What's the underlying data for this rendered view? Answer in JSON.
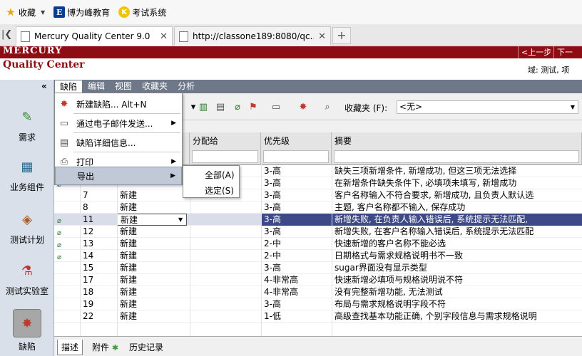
{
  "favorites_bar": {
    "favorites_label": "收藏",
    "links": [
      {
        "icon": "e-logo-icon",
        "label": "博为峰教育"
      },
      {
        "icon": "k-logo-icon",
        "label": "考试系统"
      }
    ]
  },
  "tabs": [
    {
      "title": "Mercury Quality Center 9.0",
      "active": true
    },
    {
      "title": "http://classone189:8080/qc...",
      "active": false
    }
  ],
  "header": {
    "logo": "MERCURY",
    "product": "Quality Center",
    "prev": "<上一步",
    "next": "下一步",
    "domain": "域: 测试, 项"
  },
  "sidebar": {
    "items": [
      {
        "label": "需求",
        "icon": "requirements-icon"
      },
      {
        "label": "业务组件",
        "icon": "business-components-icon"
      },
      {
        "label": "测试计划",
        "icon": "test-plan-icon"
      },
      {
        "label": "测试实验室",
        "icon": "test-lab-icon"
      },
      {
        "label": "缺陷",
        "icon": "defects-icon"
      }
    ]
  },
  "menubar": [
    "缺陷",
    "编辑",
    "视图",
    "收藏夹",
    "分析"
  ],
  "toolbar": {
    "favorites_label": "收藏夹 (F):",
    "favorites_value": "<无>"
  },
  "grid": {
    "columns": {
      "assign": "分配给",
      "priority": "优先级",
      "summary": "摘要"
    },
    "rows": [
      {
        "id": "",
        "status": "",
        "priority": "3-高",
        "summary": "缺失三项新增条件, 新增成功, 但这三项无法选择",
        "attach": false
      },
      {
        "id": "",
        "status": "",
        "priority": "3-高",
        "summary": "在新增条件缺失条件下, 必填项未填写, 新增成功",
        "attach": true
      },
      {
        "id": "7",
        "status": "新建",
        "priority": "3-高",
        "summary": "客户名称输入不符合要求, 新增成功, 且负责人默认选",
        "attach": false
      },
      {
        "id": "8",
        "status": "新建",
        "priority": "3-高",
        "summary": "主题, 客户名称都不输入, 保存成功",
        "attach": false
      },
      {
        "id": "11",
        "status": "新建",
        "priority": "3-高",
        "summary": "新增失败, 在负责人输入错误后, 系统提示无法匹配,",
        "attach": true,
        "selected": true
      },
      {
        "id": "12",
        "status": "新建",
        "priority": "3-高",
        "summary": "新增失败, 在客户名称输入错误后, 系统提示无法匹配",
        "attach": true
      },
      {
        "id": "13",
        "status": "新建",
        "priority": "2-中",
        "summary": "快速新增的客户名称不能必选",
        "attach": true
      },
      {
        "id": "14",
        "status": "新建",
        "priority": "2-中",
        "summary": "日期格式与需求规格说明书不一致",
        "attach": true
      },
      {
        "id": "15",
        "status": "新建",
        "priority": "3-高",
        "summary": "sugar界面没有显示类型",
        "attach": false
      },
      {
        "id": "17",
        "status": "新建",
        "priority": "4-非常高",
        "summary": "快速新增必填项与规格说明说不符",
        "attach": false
      },
      {
        "id": "18",
        "status": "新建",
        "priority": "4-非常高",
        "summary": "没有完整新增功能, 无法测试",
        "attach": false
      },
      {
        "id": "19",
        "status": "新建",
        "priority": "3-高",
        "summary": "布局与需求规格说明字段不符",
        "attach": false
      },
      {
        "id": "22",
        "status": "新建",
        "priority": "1-低",
        "summary": "高级查找基本功能正确, 个别字段信息与需求规格说明",
        "attach": false
      }
    ]
  },
  "bottom_tabs": [
    "描述",
    "附件",
    "历史记录"
  ],
  "defects_menu": {
    "items": [
      {
        "label": "新建缺陷...   Alt+N",
        "icon": "new-defect-icon",
        "submenu": false
      },
      {
        "label": "通过电子邮件发送...",
        "icon": "email-icon",
        "submenu": true
      },
      {
        "label": "缺陷详细信息...",
        "icon": "defect-details-icon",
        "submenu": false
      },
      {
        "label": "打印",
        "icon": "print-icon",
        "submenu": true
      },
      {
        "label": "导出",
        "icon": "",
        "submenu": true,
        "highlighted": true
      }
    ],
    "export_submenu": [
      "全部(A)",
      "选定(S)"
    ]
  }
}
